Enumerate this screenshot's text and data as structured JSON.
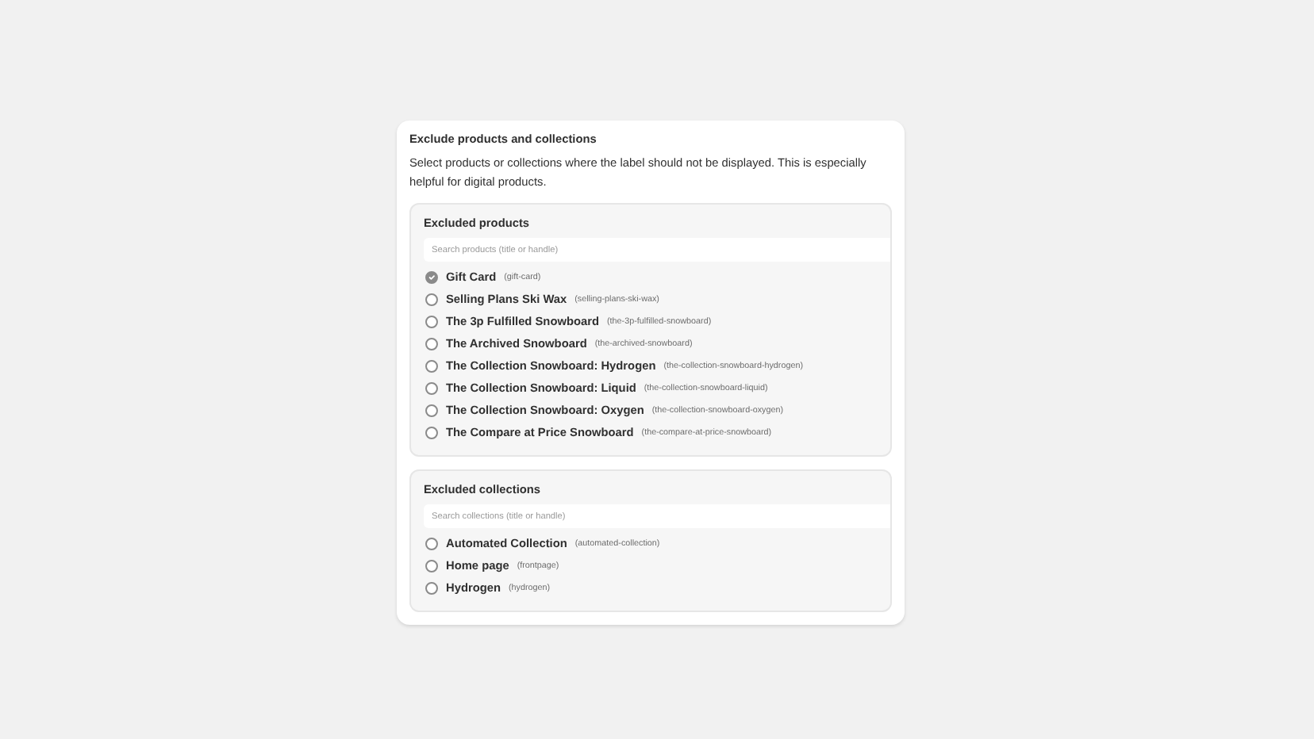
{
  "title": "Exclude products and collections",
  "description": "Select products or collections where the label should not be displayed. This is especially helpful for digital products.",
  "sections": [
    {
      "heading": "Excluded products",
      "search": {
        "placeholder": "Search products (title or handle)"
      },
      "items": [
        {
          "name": "Gift Card",
          "handle": "(gift-card)",
          "checked": true
        },
        {
          "name": "Selling Plans Ski Wax",
          "handle": "(selling-plans-ski-wax)",
          "checked": false
        },
        {
          "name": "The 3p Fulfilled Snowboard",
          "handle": "(the-3p-fulfilled-snowboard)",
          "checked": false
        },
        {
          "name": "The Archived Snowboard",
          "handle": "(the-archived-snowboard)",
          "checked": false
        },
        {
          "name": "The Collection Snowboard: Hydrogen",
          "handle": "(the-collection-snowboard-hydrogen)",
          "checked": false
        },
        {
          "name": "The Collection Snowboard: Liquid",
          "handle": "(the-collection-snowboard-liquid)",
          "checked": false
        },
        {
          "name": "The Collection Snowboard: Oxygen",
          "handle": "(the-collection-snowboard-oxygen)",
          "checked": false
        },
        {
          "name": "The Compare at Price Snowboard",
          "handle": "(the-compare-at-price-snowboard)",
          "checked": false
        }
      ]
    },
    {
      "heading": "Excluded collections",
      "search": {
        "placeholder": "Search collections (title or handle)"
      },
      "items": [
        {
          "name": "Automated Collection",
          "handle": "(automated-collection)",
          "checked": false
        },
        {
          "name": "Home page",
          "handle": "(frontpage)",
          "checked": false
        },
        {
          "name": "Hydrogen",
          "handle": "(hydrogen)",
          "checked": false
        }
      ]
    }
  ]
}
